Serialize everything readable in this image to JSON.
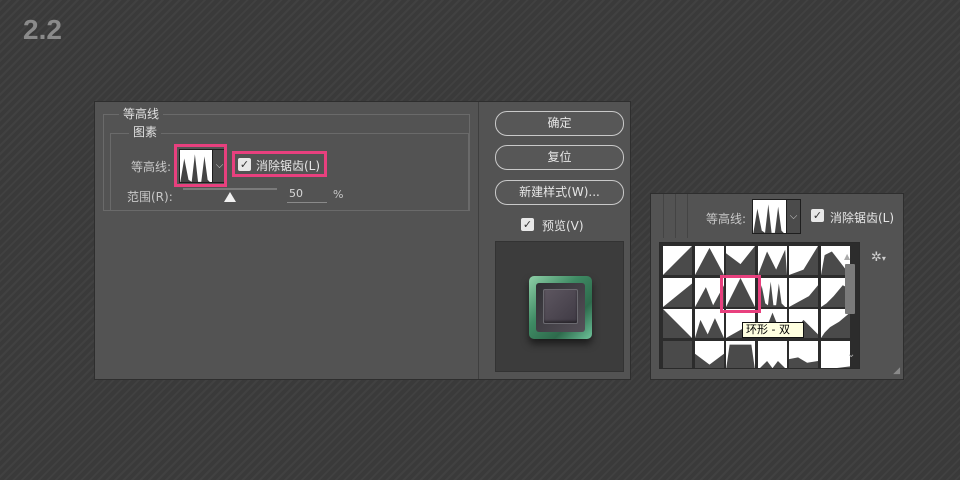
{
  "step_label": "2.2",
  "dialog": {
    "group_title": "等高线",
    "section_title": "图素",
    "contour_label": "等高线:",
    "antialias_label": "消除锯齿(L)",
    "antialias_checked": true,
    "range_label": "范围(R):",
    "range_value": "50",
    "range_unit": "%",
    "range_fraction": 0.5,
    "buttons": {
      "ok": "确定",
      "reset": "复位",
      "new_style": "新建样式(W)..."
    },
    "preview_label": "预览(V)",
    "preview_checked": true
  },
  "picker": {
    "contour_label": "等高线:",
    "antialias_label": "消除锯齿(L)",
    "antialias_checked": true,
    "tooltip": "环形 - 双",
    "selected_index": 9,
    "cell_count": 24
  },
  "colors": {
    "highlight": "#e8407e",
    "accent_green": "#3e8a63"
  },
  "icons": {
    "check": "checkmark-icon",
    "dropdown": "chevron-down-icon",
    "settings": "gear-icon"
  }
}
